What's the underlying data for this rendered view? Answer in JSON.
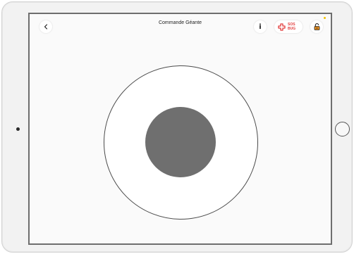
{
  "header": {
    "title": "Commande Géante",
    "info_label": "i",
    "sos_line1": "SOS",
    "sos_line2": "BUG"
  },
  "icons": {
    "back": "chevron-left-icon",
    "sos": "medical-cross-icon",
    "lock": "unlocked-padlock-icon"
  },
  "colors": {
    "sos_red": "#e23b3b",
    "lock_orange": "#e08a1e",
    "knob_gray": "#6f6f6f",
    "notification_yellow": "#f2c200"
  }
}
